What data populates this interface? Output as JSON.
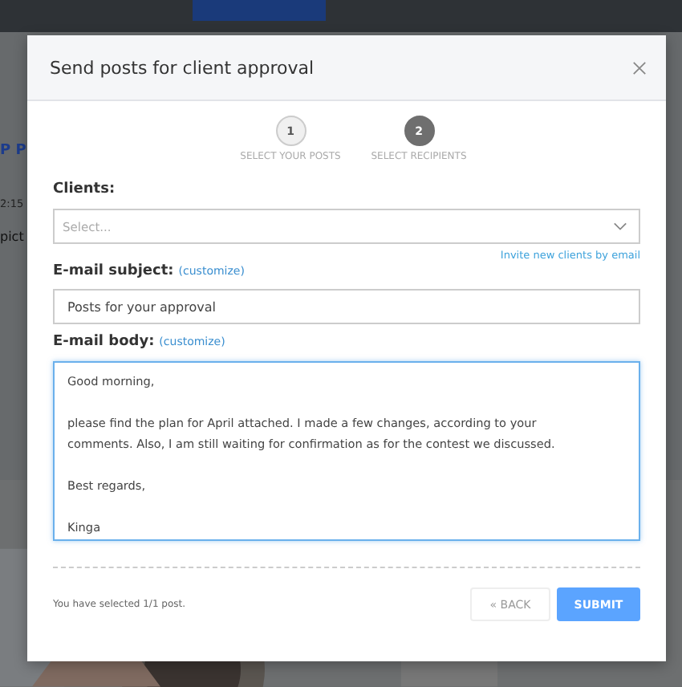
{
  "background": {
    "fragments": [
      {
        "kind": "link",
        "text": "P P"
      },
      {
        "kind": "time",
        "text": "2:15"
      },
      {
        "kind": "text",
        "text": "pict"
      }
    ]
  },
  "dialog": {
    "title": "Send posts for client approval",
    "steps": [
      {
        "number": "1",
        "label": "SELECT YOUR POSTS",
        "selected": false
      },
      {
        "number": "2",
        "label": "SELECT RECIPIENTS",
        "selected": true
      }
    ],
    "clients": {
      "label": "Clients:",
      "placeholder": "Select..."
    },
    "invite_link": "Invite new clients by email",
    "subject": {
      "label": "E-mail subject:",
      "customize": "(customize)",
      "value": "Posts for your approval"
    },
    "body": {
      "label": "E-mail body:",
      "customize": "(customize)",
      "focused": true,
      "value": "Good morning,\n\nplease find the plan for April attached. I made a few changes, according to your comments. Also, I am still waiting for confirmation as for the contest we discussed.\n\nBest regards,\n\nKinga"
    },
    "footer_note": "You have selected 1/1 post.",
    "buttons": [
      {
        "kind": "secondary",
        "label": "« BACK"
      },
      {
        "kind": "primary",
        "label": "SUBMIT"
      }
    ]
  }
}
